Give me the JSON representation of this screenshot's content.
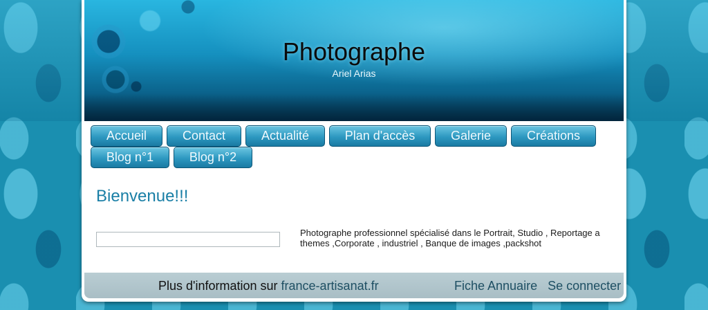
{
  "header": {
    "title": "Photographe",
    "subtitle": "Ariel Arias"
  },
  "nav": {
    "items": [
      {
        "label": "Accueil"
      },
      {
        "label": "Contact"
      },
      {
        "label": "Actualité"
      },
      {
        "label": "Plan d'accès"
      },
      {
        "label": "Galerie"
      },
      {
        "label": "Créations"
      },
      {
        "label": "Blog n°1"
      },
      {
        "label": "Blog n°2"
      }
    ]
  },
  "main": {
    "heading": "Bienvenue!!!",
    "description": "Photographe professionnel spécialisé dans le Portrait, Studio , Reportage a themes ,Corporate , industriel , Banque de images ,packshot"
  },
  "footer": {
    "info_prefix": "Plus d'information sur",
    "info_link": "france-artisanat.fr",
    "annuaire_link": "Fiche Annuaire",
    "login_link": "Se connecter"
  },
  "colors": {
    "accent": "#1a7fa6",
    "nav_button": "#2d98c0",
    "footer_bg": "#b9cdd3"
  }
}
